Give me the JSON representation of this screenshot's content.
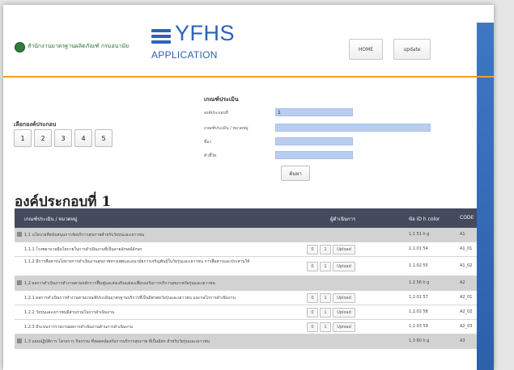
{
  "header": {
    "department": "สำนักงานมาตรฐานผลิตภัณฑ์ กรมอนามัย",
    "app_title": "YFHS",
    "app_subtitle": "APPLICATION",
    "home_label": "HOME",
    "update_label": "update"
  },
  "selector": {
    "label": "เลือกองค์ประกอบ",
    "buttons": [
      "1",
      "2",
      "3",
      "4",
      "5"
    ]
  },
  "criteria": {
    "title": "เกณฑ์ประเมิน",
    "fields": [
      {
        "label": "องค์ประกอบที่",
        "value": "1"
      },
      {
        "label": "เกณฑ์ประเมิน / หมวดหมู่",
        "value": ""
      },
      {
        "label": "ที่มา",
        "value": ""
      },
      {
        "label": "ตัวชี้วัด",
        "value": ""
      }
    ],
    "search_label": "ค้นหา"
  },
  "section_heading": "องค์ประกอบที่ 1",
  "table": {
    "headers": {
      "criteria": "เกณฑ์ประเมิน / หมวดหมู่",
      "actions": "ผู้ดำเนินการ",
      "indicators": "ข้อ  ID  h  color",
      "code": "CODE"
    },
    "action_buttons": {
      "b1": "0",
      "b2": "1",
      "upload": "Upload"
    },
    "rows": [
      {
        "type": "group",
        "text": "1.1 นโยบายที่สนับสนุนการจัดบริการสุขภาพสำหรับวัยรุ่นและเยาวชน",
        "ind": "1.1  51  h  g",
        "code": "A1"
      },
      {
        "type": "item",
        "text": "1.1.1 โรงพยาบาลมีนโยบายในการดำเนินงานที่เป็นลายลักษณ์อักษร",
        "ind": "1.1.01  54",
        "code": "A1_01"
      },
      {
        "type": "item",
        "tall": true,
        "text": "1.1.2 มีการสื่อสารนโยบายการดำเนินงานสุขภาพทางเพศและอนามัยการเจริญพันธุ์ในวัยรุ่นและเยาวชน การสื่อสารและประสานให้",
        "ind": "1.1.02  55",
        "code": "A1_02"
      },
      {
        "type": "group",
        "text": "1.2 ผลการดำเนินการทำงานตามหลักการฟื้นฟูและส่งเสริมแต่ละเพื่อรองรับการบริการสุขภาพวัยรุ่นและเยาวชน",
        "ind": "1.2  56  h  g",
        "code": "A2"
      },
      {
        "type": "item",
        "text": "1.2.1 ผลการดำเนินการทำงานตามเกณฑ์ประเมินมาตรฐานบริการที่เป็นมิตรต่อวัยรุ่นและเยาวชน และกลไกการดำเนินงาน",
        "ind": "1.2.01  57",
        "code": "A2_01"
      },
      {
        "type": "item",
        "text": "1.2.2 วัยรุ่นและเยาวชนมีส่วนร่วมในการดำเนินงาน",
        "ind": "1.2.02  58",
        "code": "A2_02"
      },
      {
        "type": "item",
        "text": "1.2.3 มีระบบการรายงานผลการดำเนินงานด้านการดำเนินงาน",
        "ind": "1.2.03  59",
        "code": "A2_03"
      },
      {
        "type": "group",
        "text": "1.3 แผนปฏิบัติการ โครงการ กิจกรรม ที่สอดคล้องกับการบริการสุขภาพ ที่เป็นมิตร สำหรับวัยรุ่นและเยาวชน",
        "ind": "1.3  60  h  g",
        "code": "A3"
      }
    ]
  }
}
